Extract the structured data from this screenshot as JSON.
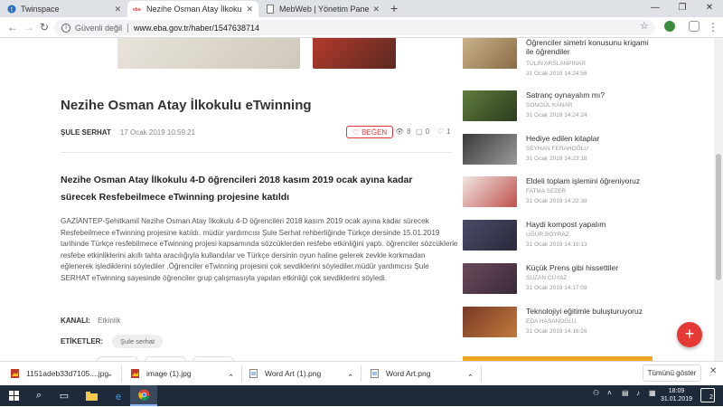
{
  "browser": {
    "tabs": [
      {
        "title": "Twinspace",
        "active": false
      },
      {
        "title": "Nezihe Osman Atay İlkokulu eTwi...",
        "active": true
      },
      {
        "title": "MebWeb | Yönetim Paneli",
        "active": false
      }
    ],
    "new_tab": "+",
    "security_label": "Güvenli değil",
    "url": "www.eba.gov.tr/haber/1547638714",
    "window_controls": {
      "minimize": "—",
      "restore": "❐",
      "close": "✕"
    }
  },
  "article": {
    "title": "Nezihe Osman Atay İlkokulu eTwinning",
    "author": "ŞULE SERHAT",
    "date": "17 Ocak 2019 10:59:21",
    "like_label": "BEĞEN",
    "views": "8",
    "comments": "0",
    "likes": "1",
    "lead": "Nezihe Osman Atay İlkokulu 4-D öğrencileri 2018 kasım 2019 ocak ayına kadar sürecek Resfebeilmece eTwinning projesine katıldı",
    "body": "GAZİANTEP-Şehitkamil Nezihe Osman Atay İlkokulu 4-D öğrencileri 2018 kasım 2019 ocak ayına kadar sürecek Resfebeilmece eTwinning projesine katıldı. müdür yardımcısı Şule Serhat rehberliğinde Türkçe dersinde 15.01.2019 tarihinde Türkçe resfebilmece eTwinning projesi kapsamında sözcüklerden resfebe etkinliğini yaptı. öğrenciler sözcüklerle resfebe etkinliklerini akıllı tahta aracılığıyla kullandılar ve Türkçe dersinin oyun haline gelerek zevkle korkmadan eğlenerek işlediklerini söylediler .Öğrenciler eTwinning projesini çok sevdiklerini söylediler.müdür yardımcısı Şule SERHAT eTwinning sayesinde öğrenciler grup çalışmasıyla yapılan etkinliği çok sevdiklerini söyledi.",
    "channel_label": "KANALI:",
    "channel_value": "Etkinlik",
    "tags_label": "ETİKETLER:",
    "tags": [
      "Şule serhat"
    ]
  },
  "sidebar": [
    {
      "title": "Öğrenciler simetri konusunu krigami ile öğrendiler",
      "author": "TÜLİN ARSLANPINAR",
      "time": "31 Ocak 2019 14:24:56"
    },
    {
      "title": "Satranç oynayalım mı?",
      "author": "SONGÜL KANAR",
      "time": "31 Ocak 2019 14:24:24"
    },
    {
      "title": "Hediye edilen kitaplar",
      "author": "SEYHAN FERAHOĞLU",
      "time": "31 Ocak 2019 14:23:18"
    },
    {
      "title": "Eldeli toplam işlemini öğreniyoruz",
      "author": "FATMA SEZER",
      "time": "31 Ocak 2019 14:22:38"
    },
    {
      "title": "Haydi kompost yapalım",
      "author": "UĞUR BOYRAZ",
      "time": "31 Ocak 2019 14:19:13"
    },
    {
      "title": "Küçük Prens gibi hissettiler",
      "author": "SUZAN CÜYAZ",
      "time": "31 Ocak 2019 14:17:09"
    },
    {
      "title": "Teknolojiyi eğitimle buluşturuyoruz",
      "author": "EDA HASANOĞLU",
      "time": "31 Ocak 2019 14:16:26"
    }
  ],
  "fab_label": "+",
  "downloads": {
    "items": [
      "1151adeb33d7105....jpg",
      "image (1).jpg",
      "Word Art (1).png",
      "Word Art.png"
    ],
    "show_all": "Tümünü göster",
    "close": "✕"
  },
  "taskbar": {
    "time": "18:09",
    "date": "31.01.2019",
    "notification_count": "2"
  },
  "colors": {
    "accent_red": "#e53935",
    "orange": "#f5a623",
    "taskbar": "#1e2a3a"
  }
}
